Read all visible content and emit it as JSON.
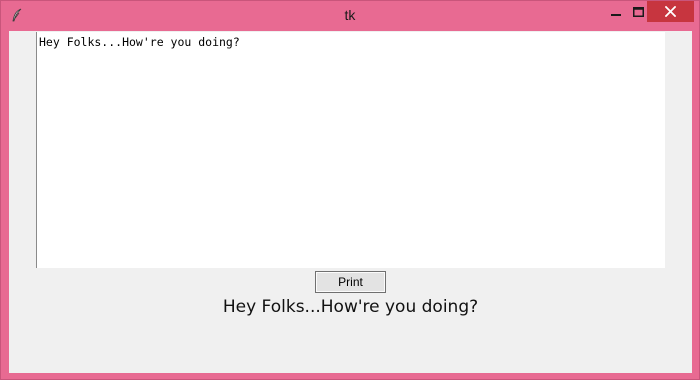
{
  "window": {
    "title": "tk",
    "frame_color": "#e86a92",
    "close_color": "#c7353f",
    "app_icon": "feather-icon"
  },
  "controls": {
    "minimize_icon": "minimize-icon",
    "maximize_icon": "maximize-icon",
    "close_icon": "close-icon"
  },
  "main": {
    "textbox_value": "Hey Folks...How're you doing?",
    "print_button_label": "Print",
    "output_label": "Hey Folks...How're you doing?"
  }
}
